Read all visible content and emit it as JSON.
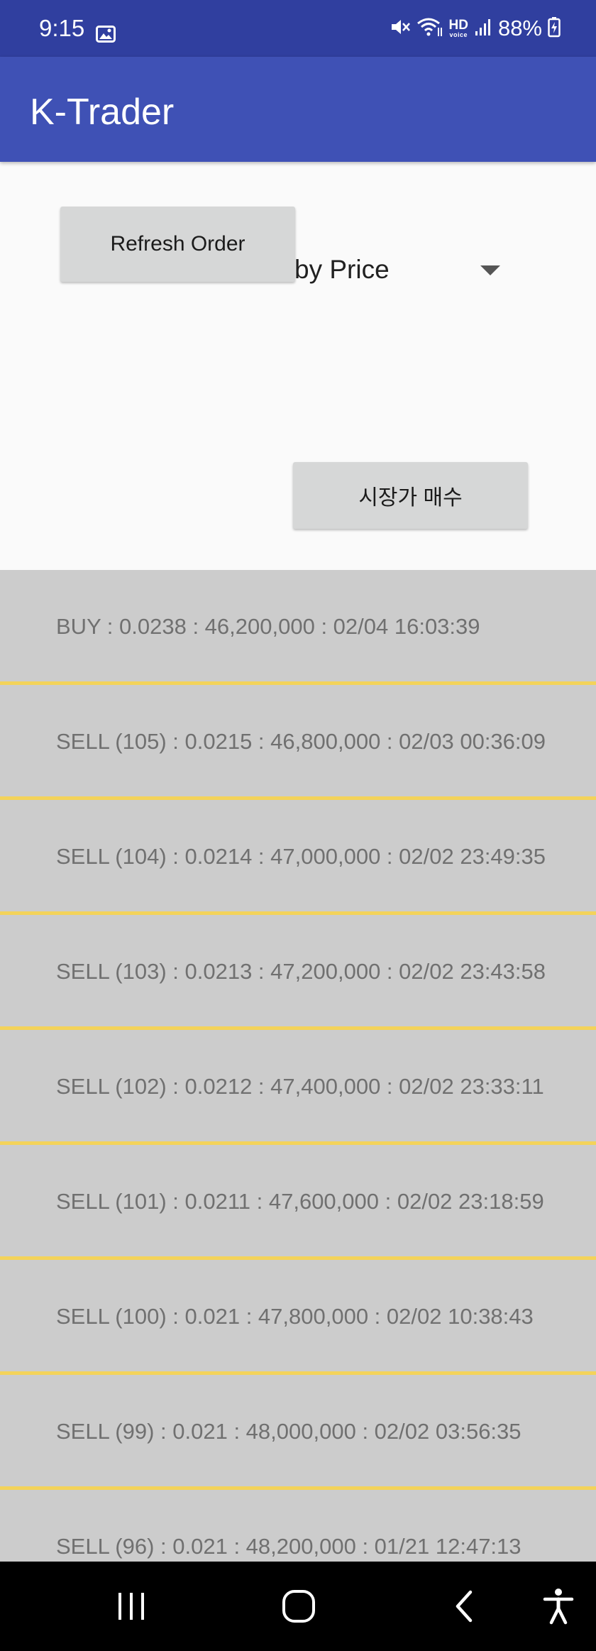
{
  "status_bar": {
    "time": "9:15",
    "hd_top": "HD",
    "hd_bottom": "voice",
    "battery": "88%",
    "icons": [
      "image-icon",
      "mute-icon",
      "wifi-icon",
      "hd-voice-icon",
      "signal-icon",
      "battery-charging-icon"
    ]
  },
  "app_bar": {
    "title": "K-Trader"
  },
  "controls": {
    "refresh_label": "Refresh Order",
    "sort_selected": "by Price",
    "market_buy_label": "시장가 매수"
  },
  "orders": [
    "BUY : 0.0238 : 46,200,000 : 02/04 16:03:39",
    "SELL (105) : 0.0215 : 46,800,000 : 02/03 00:36:09",
    "SELL (104) : 0.0214 : 47,000,000 : 02/02 23:49:35",
    "SELL (103) : 0.0213 : 47,200,000 : 02/02 23:43:58",
    "SELL (102) : 0.0212 : 47,400,000 : 02/02 23:33:11",
    "SELL (101) : 0.0211 : 47,600,000 : 02/02 23:18:59",
    "SELL (100) : 0.021 : 47,800,000 : 02/02 10:38:43",
    "SELL (99) : 0.021 : 48,000,000 : 02/02 03:56:35",
    "SELL (96) : 0.021 : 48,200,000 : 01/21 12:47:13"
  ],
  "colors": {
    "status_bar": "#303f9f",
    "app_bar": "#3f51b5",
    "list_background": "#cccccc",
    "divider": "#f3d35a",
    "nav_bar": "#000000"
  },
  "nav_bar": {
    "icons": [
      "recent-apps-icon",
      "home-icon",
      "back-icon",
      "accessibility-icon"
    ]
  }
}
